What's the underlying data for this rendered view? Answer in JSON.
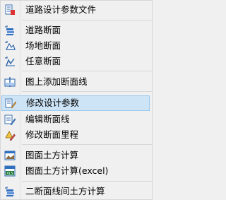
{
  "menu": {
    "items": [
      {
        "label": "道路设计参数文件",
        "icon": "road-params-file-icon"
      },
      {
        "label": "道路断面",
        "icon": "road-section-icon"
      },
      {
        "label": "场地断面",
        "icon": "site-section-icon"
      },
      {
        "label": "任意断面",
        "icon": "arbitrary-section-icon"
      },
      {
        "label": "图上添加断面线",
        "icon": "add-section-line-icon"
      },
      {
        "label": "修改设计参数",
        "icon": "edit-params-icon"
      },
      {
        "label": "编辑断面线",
        "icon": "edit-section-line-icon"
      },
      {
        "label": "修改断面里程",
        "icon": "edit-section-mileage-icon"
      },
      {
        "label": "图面土方计算",
        "icon": "earthwork-calc-icon"
      },
      {
        "label": "图面土方计算(excel)",
        "icon": "earthwork-calc-excel-icon"
      },
      {
        "label": "二断面线间土方计算",
        "icon": "two-section-earthwork-icon"
      }
    ],
    "highlighted_index": 5,
    "colors": {
      "background": "#f0f0f0",
      "highlight_fill": "#cde4f7",
      "highlight_border": "#99c9ef",
      "separator": "#d7d7d7"
    }
  }
}
